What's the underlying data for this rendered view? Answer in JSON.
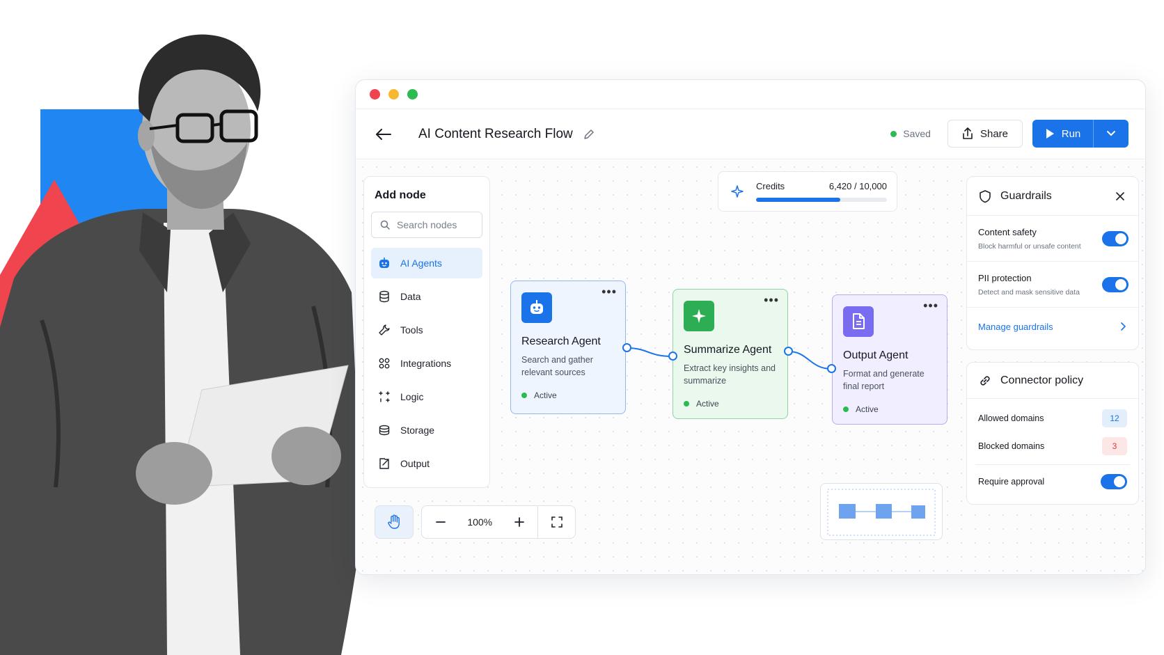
{
  "window": {
    "title": "AI Content Research Flow",
    "status": "Saved",
    "share_label": "Share",
    "run_label": "Run"
  },
  "add_node": {
    "title": "Add node",
    "search_placeholder": "Search nodes",
    "items": [
      {
        "label": "AI Agents",
        "icon": "bot-icon",
        "active": true
      },
      {
        "label": "Data",
        "icon": "database-icon"
      },
      {
        "label": "Tools",
        "icon": "wrench-icon"
      },
      {
        "label": "Integrations",
        "icon": "integrations-icon"
      },
      {
        "label": "Logic",
        "icon": "logic-icon"
      },
      {
        "label": "Storage",
        "icon": "storage-icon"
      },
      {
        "label": "Output",
        "icon": "output-icon"
      }
    ]
  },
  "credits": {
    "label": "Credits",
    "value_text": "6,420 / 10,000",
    "used": 6420,
    "total": 10000
  },
  "nodes": [
    {
      "title": "Research Agent",
      "description": "Search and gather relevant sources",
      "status": "Active",
      "icon": "bot-icon",
      "color": "#1a73e8"
    },
    {
      "title": "Summarize Agent",
      "description": "Extract key insights and summarize",
      "status": "Active",
      "icon": "sparkle-icon",
      "color": "#2dae55"
    },
    {
      "title": "Output Agent",
      "description": "Format and generate final report",
      "status": "Active",
      "icon": "document-icon",
      "color": "#7a6cf0"
    }
  ],
  "guardrails": {
    "title": "Guardrails",
    "items": [
      {
        "label": "Content safety",
        "description": "Block harmful or unsafe content",
        "enabled": true
      },
      {
        "label": "PII protection",
        "description": "Detect and mask sensitive data",
        "enabled": true
      }
    ],
    "manage_label": "Manage guardrails"
  },
  "connector_policy": {
    "title": "Connector policy",
    "allowed_label": "Allowed domains",
    "allowed_count": "12",
    "blocked_label": "Blocked domains",
    "blocked_count": "3",
    "approval_label": "Require approval",
    "approval_enabled": true
  },
  "zoom": {
    "level": "100%"
  },
  "colors": {
    "accent": "#1a73e8",
    "success": "#2dbb51",
    "danger": "#e03a3a"
  }
}
